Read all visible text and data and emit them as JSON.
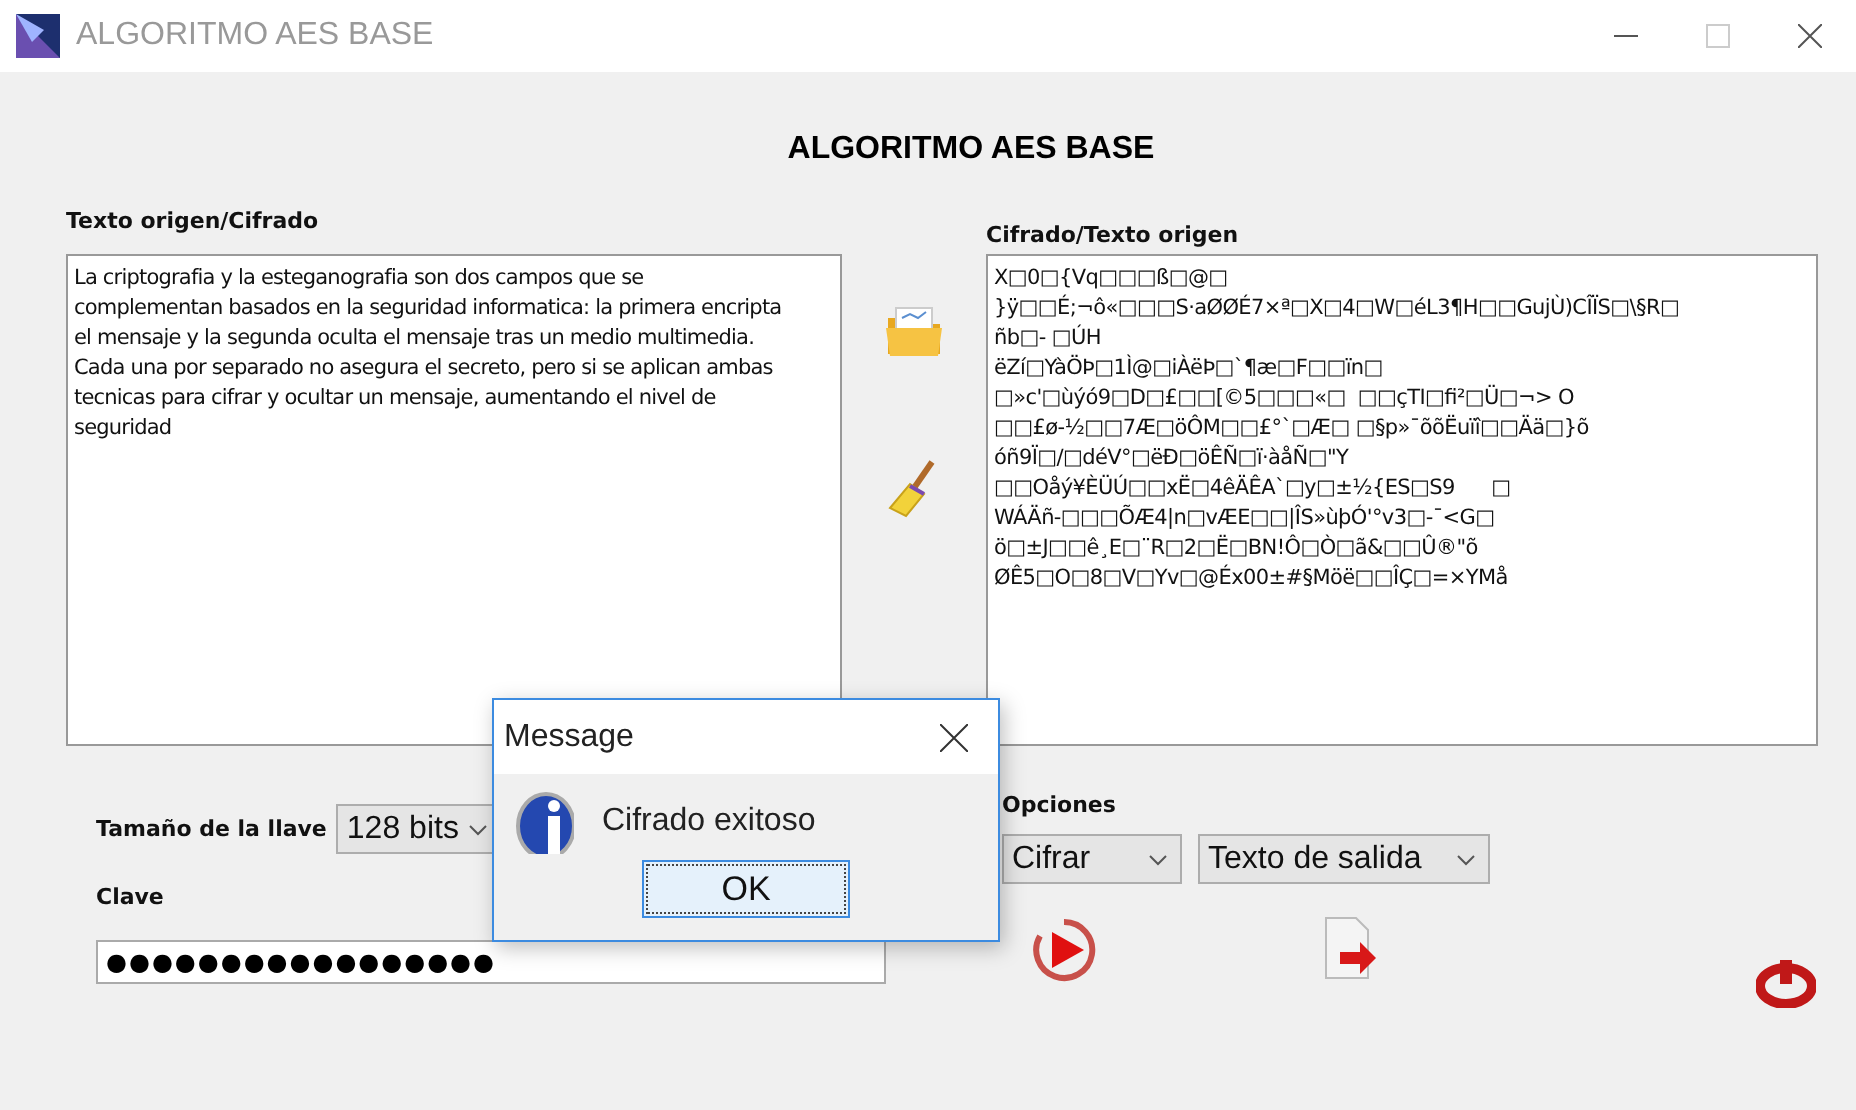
{
  "window": {
    "title": "ALGORITMO AES BASE",
    "controls": [
      {
        "kind": "minimize",
        "disabled": false
      },
      {
        "kind": "maximize",
        "disabled": true
      },
      {
        "kind": "close",
        "disabled": false
      }
    ]
  },
  "heading": "ALGORITMO AES BASE",
  "source": {
    "label": "Texto origen/Cifrado",
    "lines": [
      "La criptografia y la esteganografia son dos campos que se",
      "complementan basados en la seguridad informatica: la primera encripta",
      "el mensaje y la segunda oculta el mensaje tras un medio multimedia.",
      "Cada una por separado no asegura el secreto, pero si se aplican ambas",
      "tecnicas para cifrar y ocultar un mensaje, aumentando el nivel de",
      "seguridad"
    ]
  },
  "output": {
    "label": "Cifrado/Texto origen",
    "lines": [
      "X□0□{Vq□□□ß□@□",
      "}ÿ□□É;¬ô«□□□S·aØØÉ7×ª□X□4□W□éL3¶H□□GujÙ)CÎÏS□\\§R□",
      "ñb□- □ÚH",
      "ëZí□YàÖÞ□1Ì@□iÀëÞ□`¶æ□F□□ïn□",
      "□»c'□ùýó9□D□£□□[©5□□□«□  □□çTI□ﬁ²□Ü□¬> O",
      "□□£ø-½□□7Æ□öÔM□□£°`□Æ□ □§p»¯õõËuïî□□Ää□}õ",
      "óñ9Ï□/□déV°□ëÐ□öÊÑ□ï·àåÑ□\"Y",
      "□□Oåý¥ÈÜÚ□□xË□4êÄÊA`□y□±½{ES□S9      □",
      "WÁÄñ-□□□ÕÆ4|n□vÆE□□|ÎS»ùþÓ'°v3□-¯<G□",
      "ö□±J□□ê¸E□¨R□2□Ë□BN!Ô□Ò□ã&□□Û®\"õ",
      "ØÊ5□O□8□V□Yv□@Éx00±#§Möë□□ÎÇ□=×YMå"
    ]
  },
  "key_size": {
    "label": "Tamaño de la llave",
    "value": "128 bits"
  },
  "key": {
    "label": "Clave",
    "value": "●●●●●●●●●●●●●●●●●"
  },
  "options": {
    "label": "Opciones",
    "mode": "Cifrar",
    "target": "Texto de salida"
  },
  "dialog": {
    "title": "Message",
    "message": "Cifrado exitoso",
    "button": "OK"
  }
}
